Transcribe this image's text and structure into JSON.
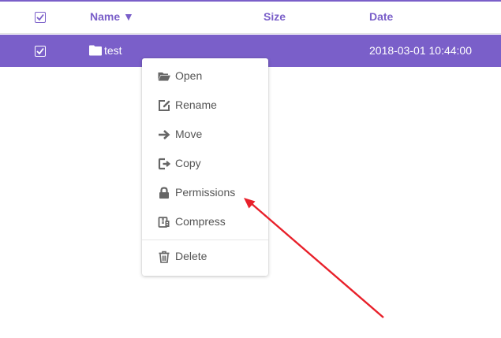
{
  "table": {
    "header": {
      "name": "Name ▼",
      "size": "Size",
      "date": "Date"
    },
    "rows": [
      {
        "name": "test",
        "size": "",
        "date": "2018-03-01 10:44:00",
        "selected": true,
        "icon": "folder-icon"
      }
    ]
  },
  "context_menu": {
    "items": [
      {
        "label": "Open",
        "icon": "folder-open-icon"
      },
      {
        "label": "Rename",
        "icon": "edit-icon"
      },
      {
        "label": "Move",
        "icon": "arrow-right-icon"
      },
      {
        "label": "Copy",
        "icon": "copy-icon"
      },
      {
        "label": "Permissions",
        "icon": "lock-icon"
      },
      {
        "label": "Compress",
        "icon": "archive-icon"
      },
      {
        "label": "Delete",
        "icon": "trash-icon"
      }
    ]
  },
  "colors": {
    "accent": "#7a5fc9",
    "annotation_arrow": "#e8202a",
    "menu_text": "#555555"
  }
}
